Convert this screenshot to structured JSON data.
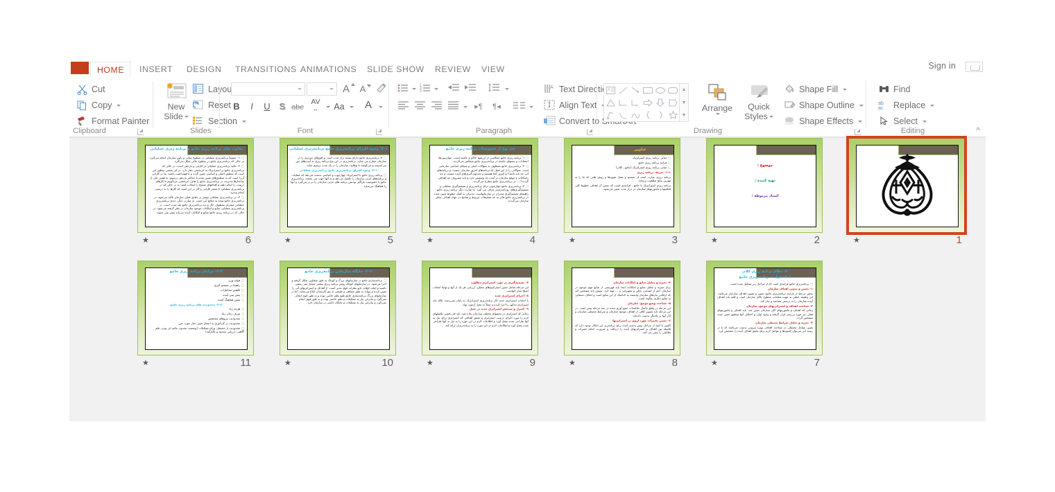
{
  "window": {
    "signin_label": "Sign in",
    "collapse_ribbon_icon": "chevron-up-icon"
  },
  "tabs": [
    {
      "id": "file",
      "label": ""
    },
    {
      "id": "home",
      "label": "HOME",
      "active": true
    },
    {
      "id": "insert",
      "label": "INSERT"
    },
    {
      "id": "design",
      "label": "DESIGN"
    },
    {
      "id": "transitions",
      "label": "TRANSITIONS"
    },
    {
      "id": "animations",
      "label": "ANIMATIONS"
    },
    {
      "id": "slideshow",
      "label": "SLIDE SHOW"
    },
    {
      "id": "review",
      "label": "REVIEW"
    },
    {
      "id": "view",
      "label": "VIEW"
    }
  ],
  "ribbon": {
    "groups": [
      {
        "id": "clipboard",
        "label": "Clipboard"
      },
      {
        "id": "slides",
        "label": "Slides"
      },
      {
        "id": "font",
        "label": "Font"
      },
      {
        "id": "paragraph",
        "label": "Paragraph"
      },
      {
        "id": "drawing",
        "label": "Drawing"
      },
      {
        "id": "editing",
        "label": "Editing"
      }
    ],
    "clipboard": {
      "cut": "Cut",
      "copy": "Copy",
      "format_painter": "Format Painter"
    },
    "slides": {
      "new_slide": "New\nSlide",
      "new_slide_line1": "New",
      "new_slide_line2": "Slide",
      "layout": "Layout",
      "reset": "Reset",
      "section": "Section"
    },
    "font": {
      "font_name_value": "",
      "font_size_value": "",
      "increase_font": "A",
      "decrease_font": "A",
      "clear_formatting": "clear-formatting-icon",
      "bold": "B",
      "italic": "I",
      "underline": "U",
      "shadow": "S",
      "strikethrough": "abc",
      "character_spacing": "AV",
      "change_case": "Aa",
      "font_color": "A"
    },
    "paragraph": {
      "text_direction": "Text Direction",
      "align_text": "Align Text",
      "convert_to_smartart": "Convert to SmartArt"
    },
    "drawing": {
      "arrange": "Arrange",
      "quick_styles_line1": "Quick",
      "quick_styles_line2": "Styles",
      "shape_fill": "Shape Fill",
      "shape_outline": "Shape Outline",
      "shape_effects": "Shape Effects",
      "shapes": [
        "text-box-icon",
        "line-icon",
        "arrow-icon",
        "rectangle-icon",
        "oval-icon",
        "rounded-rectangle-icon",
        "triangle-icon",
        "elbow-connector-icon",
        "elbow-arrow-connector-icon",
        "right-arrow-icon",
        "down-arrow-icon",
        "pentagon-icon",
        "scribble-icon",
        "arc-icon",
        "curve-icon",
        "left-brace-icon",
        "right-brace-icon",
        "star-icon"
      ]
    },
    "editing": {
      "find": "Find",
      "replace": "Replace",
      "select": "Select"
    }
  },
  "sorter": {
    "slides": [
      {
        "number": "6",
        "selected": false,
        "animated": true,
        "title": "تفاوت های برنامه ریزی جامع و برنامه ریزی عملیاتی",
        "title_on_block": false,
        "body": [
          {
            "style": "bul",
            "text": "۱– عموماً برنامه‌ریزی عملیاتی در سطوح میانی و پایین سازمان انجام می‌گیرد، در حالی که برنامه‌ریزی جامع در سطوح عالی شکل می‌گیرد."
          },
          {
            "style": "bul",
            "text": "۲– تاکید برنامه‌ریزی عملیاتی بر کارایی و بازدهی است، در حالی که برنامه‌ریزی جامع بر استراتژیک به اثربخشی نظر دارد. در اثر بخشی منظور این است که منطبق اصلی و اساسی تعیین گردد و با فهم‌داشت باشید. ما در کارایی آن‌را است که به منطبق‌های تعیین شده با حداکثر بازدهی برسیم، به همین یکی از ساختارها مدیریت در برنامه‌ریزی جامع را هدف اثربخشی می‌گوییم تا کارهای درست را انجام دهند و اهدافهای صحیح را انتخاب کنیم؛ به در حالی که در برنامه‌ریزی عملیاتی با عنصر کارایی و کار در این است که کارها را به درستی انجام بپذیرد."
          },
          {
            "style": "bul",
            "text": "۳– در برنامه‌ریزی عملیاتی بیشتر بر دقایق فعلی سازمان تاکید می‌شود، در برنامه‌ریزی جامع توجه به منافع آتی است. به عبارت دیگر، دیدی برنامه‌ریزی عملیاتی متمرکز معطوف حال و دید برنامه‌ریزی جامع بلند مدت است. در برنامه‌ریزی عملیاتی منابع و امکانات موجود سازمان در نظر گرفته می‌شود، در حالی که در برنامه ریزی جامع منابع و امکانات آینده می‌باید پیش بینی شوند."
          }
        ]
      },
      {
        "number": "5",
        "selected": false,
        "animated": true,
        "title": "۱–۲– وجوه افتراق برنامه‌ریزی جامع برنامه‌ریزی عملیاتی",
        "title_inline": true,
        "body": [
          {
            "style": "bul",
            "text": "۴: برنامه‌ریزی جامع دارای نتیجه دراز مدت است و افق‌های دورتری را در سازمان مطرح می سازد. برنامه‌ریزی در این نوع برنامه ریزی به آینده‌های دور می‌اندیشد و می‌کوشد تا وظایف سازمان را در یک مدت ترسیم نماید."
          },
          {
            "style": "hd2",
            "text": "۱–۲– وجوه افتراق برنامه‌ریزی جامع برنامه‌ریزی عملیاتی"
          },
          {
            "style": "bul",
            "text": "برنامه ریزی جامع یا استراتژیک چهارچوب و اساسی بدست می‌دهد که عملیات و برنامه‌های جزئی سازمان را تکمیل می‌دهد و به آنها جهت می بخشد. برنامه‌ریزی جامع با خصوصیت فراگیر بودنش برنامه های جزئی سازمان را در بر می‌گیرد و آنها را هماهنگ می‌سازد."
          }
        ]
      },
      {
        "number": "4",
        "selected": false,
        "animated": true,
        "title": "چند نوع از خصوصیات برنامه ریزی جامع",
        "title_on_block": false,
        "body": [
          {
            "style": "bul",
            "text": "۱: برنامه ریزی جامع انعکاسی از ارزشها حاکم و جامعه است. جهان‌بینی‌ها، اعتقادات و سنتهای جامعه در برنامه‌ریزی جامع منعکس می‌گردند."
          },
          {
            "style": "bul",
            "text": "۲: برنامه‌ریزی جامع معطوف به سؤالات اصلی و مسائل اساسی سازمانی است. سؤالاتی را از این قبیل که برنامه‌های امروز سازمان چیست و برنامه‌های آتی چه باید باشد؟ و امروز کجا هستیم و چه‌جهت‌گیری‌های آینده چیست و چه رامکانات و موقع سازمان در آینده چه وضعیتی دارد و بایه مصروف چه اهدافی گردند؟…. در برنامه‌ریزی جامع مطرح می‌گردند."
          },
          {
            "style": "bul",
            "text": "۳: برنامه‌ریزی جامع چهارچوبی برای برنامه‌ریزی و تصمیم‌گیری عملیاتی و تصمیم‌گیری‌های روزانه‌تری‌تر عراف می آورد. به عبارت دیگر برنامه ریزی جامع راهنمای تصمیم‌گیری مدیران در سازمانهاست. مدیران به کمک خطوط تعیین شده در برنامه‌ریزی جامع قادر به خذ تصمیمات مربوط و صحیح در جهت اهداف عملی سازمان می‌گردند."
          }
        ]
      },
      {
        "number": "3",
        "selected": false,
        "animated": true,
        "title": "عناوین",
        "title_on_block": true,
        "body": [
          {
            "style": "bul",
            "text": "مبانی برنامه ریزی استراتژیک"
          },
          {
            "style": "bul",
            "text": "فرایند برنامه ریزی جامع"
          },
          {
            "style": "bul",
            "text": "مبانی برنامه ریزی استراتژیک (جامع ، کلان)"
          },
          {
            "style": "hd",
            "text": "۱–۱– تعریف برنامه ریزی"
          },
          {
            "style": "plain",
            "text": "برنامه ریزی عبارت است از تصمیم و تعقل شیوه‌ها و روش هایی که ما را به بهترین نتایج مطلوب برساند."
          },
          {
            "style": "plain",
            "text": "برنامه ریزی استراتژیک یا جامع ، فرایندی است که ضمن آن اهداف خطوط کلی فعالیتها و ماموریتهای سازمان در دراز مدت تعیین می‌شود."
          }
        ]
      },
      {
        "number": "2",
        "selected": false,
        "animated": true,
        "title": "",
        "title_on_block": false,
        "cover": true,
        "cover_lines": [
          {
            "text": "موضوع :",
            "color": "#c00000"
          },
          {
            "text": "تهیه کننده :",
            "color": "#0f9b4a"
          },
          {
            "text": "استاد مربوطه :",
            "color": "#7030a0"
          }
        ]
      },
      {
        "number": "1",
        "selected": true,
        "animated": true,
        "title": "",
        "title_on_block": false,
        "bismillah": true
      },
      {
        "number": "11",
        "selected": false,
        "animated": true,
        "title": "۳–۲– مزایای برنامه ریزی جامع",
        "title_on_block": false,
        "body": [
          {
            "style": "bul",
            "text": "فواید وزن"
          },
          {
            "style": "bul",
            "text": "راهنما در تصمیم گیری"
          },
          {
            "style": "bul",
            "text": "کاهش مخاطرات"
          },
          {
            "style": "bul",
            "text": "پیش بینی آینده"
          },
          {
            "style": "bul",
            "text": "نقش هماهنگ کننده"
          },
          {
            "style": "hd2",
            "text": "۴–۲– محدودیت های برنامه ریزی جامع"
          },
          {
            "style": "bul",
            "text": "هزینه زیاد"
          },
          {
            "style": "bul",
            "text": "صرف زمان زیاد"
          },
          {
            "style": "bul",
            "text": "محدودیت نیروهای متخصص"
          },
          {
            "style": "bul",
            "text": "محدودیت در گردآوری به اعمال تغییر دچار چوب حین"
          },
          {
            "style": "bul",
            "text": "محدودیت از محیطی ورای تشکیلات (وضعیت محدود، مالیه اثر بودن، قلم آگاهی، ارزیابی محدود و ناکارآمد)"
          }
        ]
      },
      {
        "number": "10",
        "selected": false,
        "animated": true,
        "title": "۴–۲– جایگاه سازمانی برنامه‌ریزی جامع",
        "title_on_block": false,
        "body": [
          {
            "style": "bul",
            "text": "برنامه‌سازی جامع در سازمانهای بزرگ و کوچک به طور متفاوتی شکل گرفته و اجرا می‌شود. در سازمانهای کوچک روش برنامه ریزی بیشتر جنبه‌ی غیر رسمی داشته و اغلب اوقات تابع نظرات قوی مدیر است. از اهداف و استراتژیهای آتی را تعیین کرده و بتواند به طور شفاهی و طبیعی به تیم کارمندان ابلاغ می‌نماید. اما در سازمانهای بزرگ برنامه‌سازی جامع طبع نظم خاصی بوده و به طور قوی انجام نمی‌گیرد و بنابراین نیاز به تشکیلات و نظم خاصی بوده و به طور قوی انجام نمی‌گیرد و بنابراین نیاز به تشکیلات و جایگاه خاصی در سازمان دارد."
          }
        ]
      },
      {
        "number": "9",
        "selected": false,
        "animated": true,
        "title": "",
        "title_on_block": false,
        "body": [
          {
            "style": "hd",
            "text": "۷– تصمیم‌گیری در مورد استراتژی مطلوب"
          },
          {
            "style": "plain",
            "text": "این مرحله شامل تعیین استراتژی‌های ممکن، ارزیابی هر یک از آنها و نهایتا انتخاب اصلح میان آنهاست."
          },
          {
            "style": "hd",
            "text": "۸– اجرای استراتژی جدید"
          },
          {
            "style": "plain",
            "text": "با انتخاب استراتژی جدید کار برنامه‌ریزی استراتژیک به پایان نمی‌رسد، بلکه باید استراتژی مذکور را اجرا کرده و عملاً به محل آزمون نهاد."
          },
          {
            "style": "hd",
            "text": "۹– کنترل و سنجش استراتژی جدید در عمل"
          },
          {
            "style": "plain",
            "text": "زمانی که استراتژی در بخشهای مختلف سازمان پیاده شد، باید هر بخشی تکمیلهای لازم را مورد اجرای درست استراتژی و تحقق اهدافی که استراتژی برای نیل به آنها طراحی شده بعمل آورد و اطلاعات لازم در این مورد را به نیل به آنها طراحی شده بعمل آورد و اطلاعات لازم در این مورد را به برنامه‌ریزان ارائه کند."
          }
        ]
      },
      {
        "number": "8",
        "selected": false,
        "animated": true,
        "title": "",
        "title_on_block": false,
        "body": [
          {
            "style": "hd",
            "text": "۴– تجزیه و تحلیل منابع و امکانات سازمان"
          },
          {
            "style": "plain",
            "text": "برای تجزیه و تحلیل منابع و امکانات ابتدا باید فهرستی از منابع مهم موجود در سازمان اعم از انسانی، مالی و تجهیزاتی و … تهیه کرد. سپس باید مشخص کند که ارقامی نیازهای سازمان وابسته به کدامیک از این منابع است و امکان دستیابی به منابع دیگری چگونه است."
          },
          {
            "style": "hd",
            "text": "۵– شناخت وضع موجود سازمان"
          },
          {
            "style": "plain",
            "text": "این مرحله در واقع حاصل خلاصه‌ات جمع آوری شده در سه مرحله پیش است. در این مرحله باید تصویر کافی از اهداف موجود سازمان و شرایط محیطی سازمان و آثار آنها بر یکدیگر بدست داده‌اید."
          },
          {
            "style": "hd",
            "text": "۶– تعیین تغییرات مورد لزوم در استراتژیها"
          },
          {
            "style": "plain",
            "text": "اکنون با آنچه از مراحل پیش بدست آمده برای برنامه‌ریز این امکان وجود دارد که فاصله‌ بین اهداف و استراتژیهای آینده را دریافت و ضرورت انجام تغییرات و تطابقی را بیمن بنی کند."
          }
        ]
      },
      {
        "number": "7",
        "selected": false,
        "animated": true,
        "title": "۲– نظام برنامه ریزی کلان",
        "title_sub": "۱–۲– فرآیند برنامه ریزی جامع",
        "title_on_block": false,
        "body": [
          {
            "style": "bul",
            "text": "برنامه‌ریزی جامع فرایندی است که از مراحل زیر تشکیل شده است."
          },
          {
            "style": "hd",
            "text": "۱– تعیین و تدوین اهداف سازمان"
          },
          {
            "style": "plain",
            "text": "بخش مرحله در فرایند برنامه‌ریزی جامع، تعیین و تصویر اهداف سازمان می‌باشد. این وظیفه خطیر به عهده مقامات سطوح بالای سازمان است و کلیه باید اهداف آینده سازمان را به درستی شناخته و بیان کند."
          },
          {
            "style": "hd",
            "text": "۲– شناخت اهداف و استراتژیهای موجود سازمان"
          },
          {
            "style": "plain",
            "text": "زمانی که اهداف و ماموریتهای کلی سازمان تعیین شد، باید اهداف و ماموریتهای فعلی نیز مورد بررسی قرار گرفته و وجود اولی و اختلاف آنها منطبق تعیین شده مشخص گردد."
          },
          {
            "style": "hd",
            "text": "۳– تجزیه و تحلیل شرایط محیطی سازمان"
          },
          {
            "style": "plain",
            "text": "تعیین عوامل محیطی در شناخت اهداف بویژه بیرونی بدست می‌باشد که با در رسید آتی می‌توان کمبودها و عوامل لازم برای تحقق اهداف آینده را مشخص کرد."
          }
        ]
      }
    ]
  }
}
